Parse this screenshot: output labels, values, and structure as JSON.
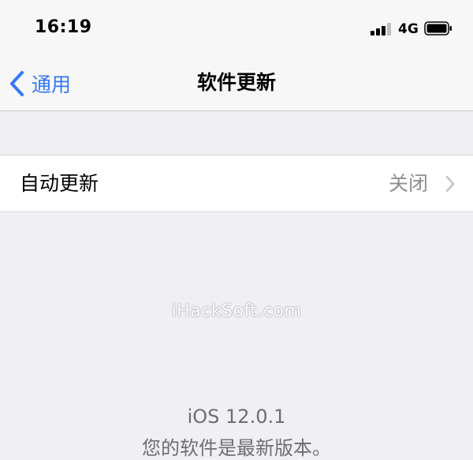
{
  "status_bar": {
    "time": "16:19",
    "network": "4G",
    "signal_bars_active": 3,
    "signal_bars_total": 4
  },
  "nav_bar": {
    "back_label": "通用",
    "title": "软件更新"
  },
  "settings": {
    "auto_update": {
      "label": "自动更新",
      "value": "关闭"
    }
  },
  "watermark": "iHackSoft.com",
  "update_status": {
    "version": "iOS 12.0.1",
    "message": "您的软件是最新版本。"
  },
  "colors": {
    "accent": "#3478f6",
    "background": "#efeff4",
    "secondary_text": "#8e8e93"
  }
}
